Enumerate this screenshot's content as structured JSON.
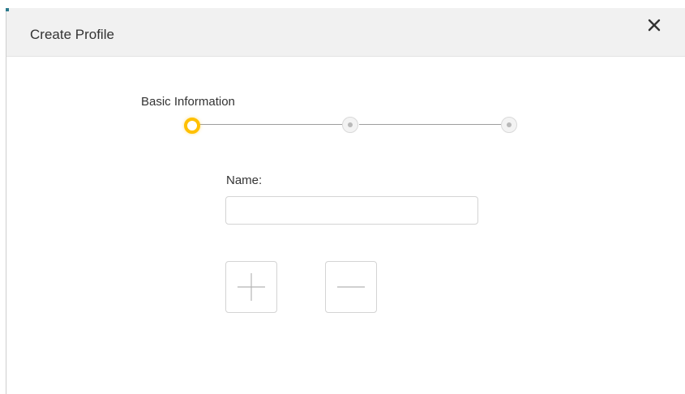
{
  "dialog": {
    "title": "Create Profile",
    "close_icon": "close-icon"
  },
  "stepper": {
    "current_step_label": "Basic Information",
    "total_steps": 3,
    "current_step": 1,
    "active_color": "#ffc000"
  },
  "form": {
    "name_label": "Name:",
    "name_value": "",
    "name_placeholder": ""
  },
  "actions": {
    "add_icon": "plus-icon",
    "remove_icon": "minus-icon"
  }
}
